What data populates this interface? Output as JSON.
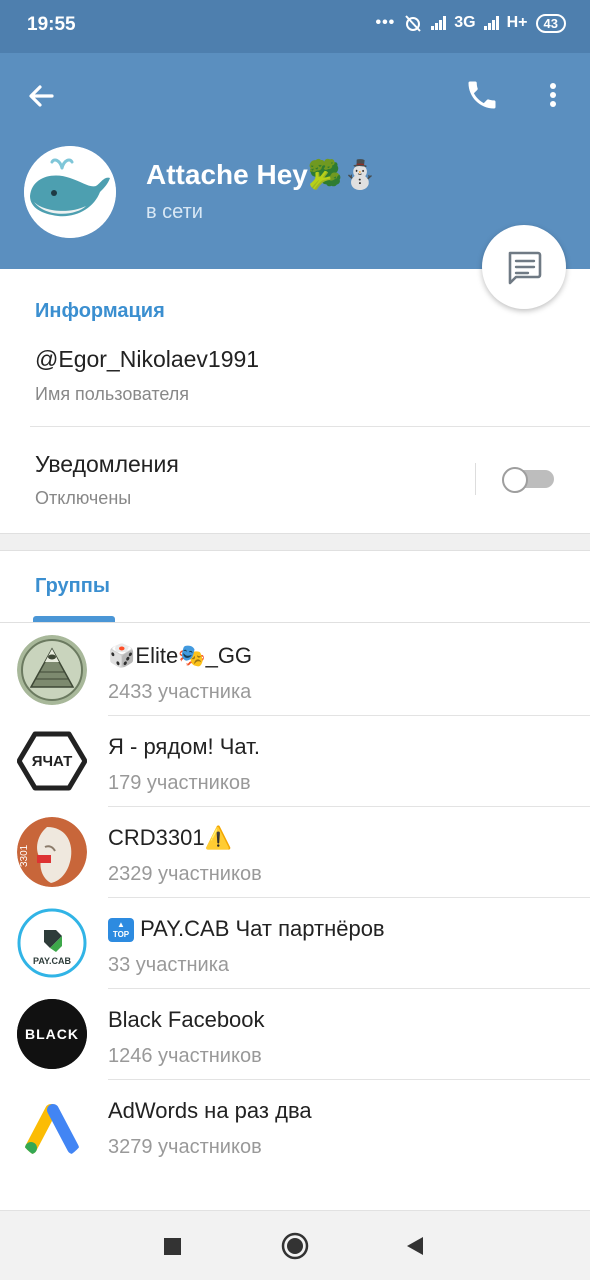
{
  "status_bar": {
    "time": "19:55",
    "network": "3G",
    "network2": "H+",
    "battery": "43"
  },
  "profile": {
    "name": "Attache Hey🥦⛄",
    "status": "в сети"
  },
  "info": {
    "section_title": "Информация",
    "username": "@Egor_Nikolaev1991",
    "username_label": "Имя пользователя",
    "notifications_title": "Уведомления",
    "notifications_state": "Отключены",
    "notifications_enabled": false
  },
  "tabs": {
    "groups_label": "Группы"
  },
  "groups": [
    {
      "name": "🎲Elite🎭_GG",
      "count": "2433 участника",
      "icon": "illuminati-avatar"
    },
    {
      "name": "Я - рядом! Чат.",
      "count": "179 участников",
      "icon": "ya-chat-avatar",
      "avatar_text": "ЯЧАТ"
    },
    {
      "name": "CRD3301⚠️",
      "count": "2329 участников",
      "icon": "statue-avatar",
      "avatar_text": "3301"
    },
    {
      "name": " PAY.CAB  Чат партнёров",
      "count": "33 участника",
      "icon": "paycab-avatar",
      "avatar_text": "PAY.CAB",
      "badge_text": "TOP"
    },
    {
      "name": "Black Facebook",
      "count": "1246 участников",
      "icon": "black-avatar",
      "avatar_text": "BLACK"
    },
    {
      "name": "AdWords на раз два",
      "count": "3279 участников",
      "icon": "adwords-avatar"
    }
  ],
  "colors": {
    "header": "#5b8fbf",
    "status_bar": "#4e7fae",
    "accent": "#3b8fd0"
  }
}
